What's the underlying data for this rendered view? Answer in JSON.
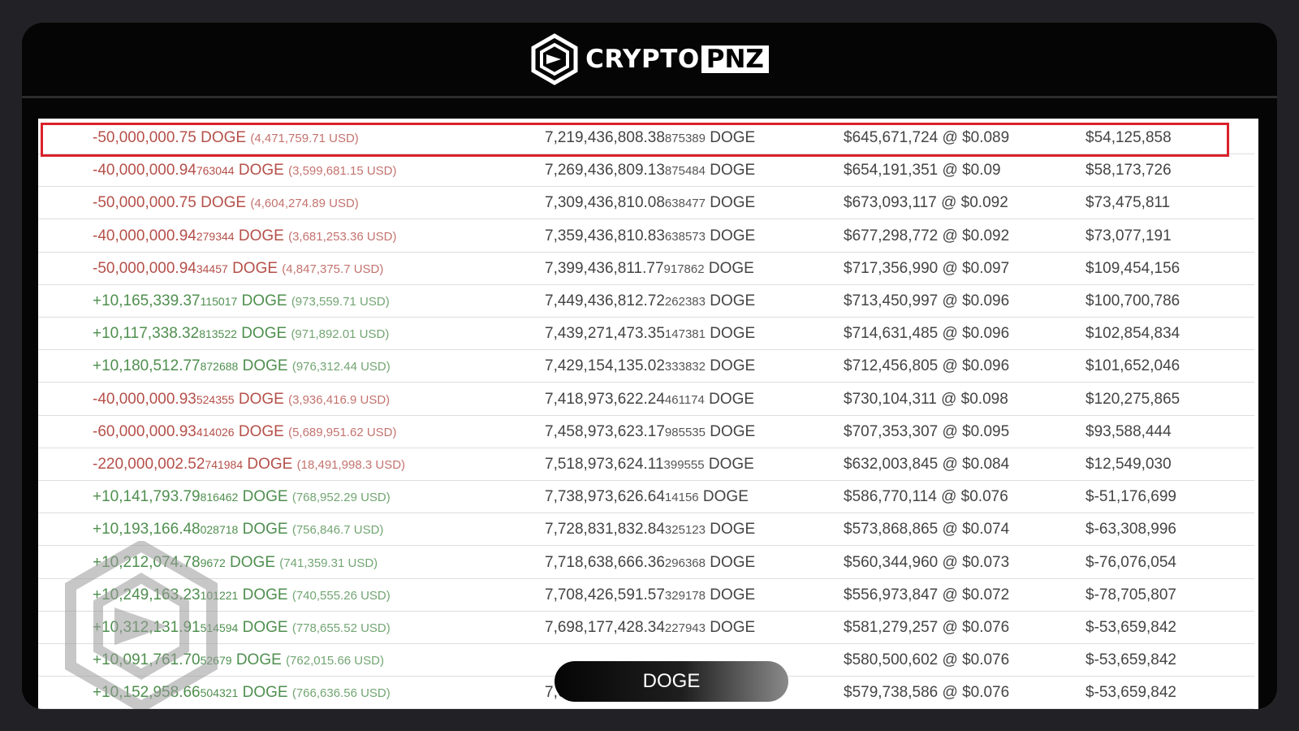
{
  "brand": {
    "name_part1": "CRYPTO",
    "name_part2": "PNZ",
    "icon": "cube-hexagon-logo-icon"
  },
  "overlay": {
    "label": "DOGE"
  },
  "colors": {
    "negative": "#b5504a",
    "positive": "#4f8f4f",
    "highlight_border": "#d9222a"
  },
  "highlighted_row": 0,
  "rows": [
    {
      "sign": "neg",
      "change_main": "-50,000,000.75",
      "change_small": "",
      "unit": "DOGE",
      "usd": "(4,471,759.71 USD)",
      "bal_main": "7,219,436,808.38",
      "bal_small": "875389",
      "bal_unit": "DOGE",
      "value": "$645,671,724 @ $0.089",
      "pnl": "$54,125,858"
    },
    {
      "sign": "neg",
      "change_main": "-40,000,000.94",
      "change_small": "763044",
      "unit": "DOGE",
      "usd": "(3,599,681.15 USD)",
      "bal_main": "7,269,436,809.13",
      "bal_small": "875484",
      "bal_unit": "DOGE",
      "value": "$654,191,351 @ $0.09",
      "pnl": "$58,173,726"
    },
    {
      "sign": "neg",
      "change_main": "-50,000,000.75",
      "change_small": "",
      "unit": "DOGE",
      "usd": "(4,604,274.89 USD)",
      "bal_main": "7,309,436,810.08",
      "bal_small": "638477",
      "bal_unit": "DOGE",
      "value": "$673,093,117 @ $0.092",
      "pnl": "$73,475,811"
    },
    {
      "sign": "neg",
      "change_main": "-40,000,000.94",
      "change_small": "279344",
      "unit": "DOGE",
      "usd": "(3,681,253.36 USD)",
      "bal_main": "7,359,436,810.83",
      "bal_small": "638573",
      "bal_unit": "DOGE",
      "value": "$677,298,772 @ $0.092",
      "pnl": "$73,077,191"
    },
    {
      "sign": "neg",
      "change_main": "-50,000,000.94",
      "change_small": "34457",
      "unit": "DOGE",
      "usd": "(4,847,375.7 USD)",
      "bal_main": "7,399,436,811.77",
      "bal_small": "917862",
      "bal_unit": "DOGE",
      "value": "$717,356,990 @ $0.097",
      "pnl": "$109,454,156"
    },
    {
      "sign": "pos",
      "change_main": "+10,165,339.37",
      "change_small": "115017",
      "unit": "DOGE",
      "usd": "(973,559.71 USD)",
      "bal_main": "7,449,436,812.72",
      "bal_small": "262383",
      "bal_unit": "DOGE",
      "value": "$713,450,997 @ $0.096",
      "pnl": "$100,700,786"
    },
    {
      "sign": "pos",
      "change_main": "+10,117,338.32",
      "change_small": "813522",
      "unit": "DOGE",
      "usd": "(971,892.01 USD)",
      "bal_main": "7,439,271,473.35",
      "bal_small": "147381",
      "bal_unit": "DOGE",
      "value": "$714,631,485 @ $0.096",
      "pnl": "$102,854,834"
    },
    {
      "sign": "pos",
      "change_main": "+10,180,512.77",
      "change_small": "872688",
      "unit": "DOGE",
      "usd": "(976,312.44 USD)",
      "bal_main": "7,429,154,135.02",
      "bal_small": "333832",
      "bal_unit": "DOGE",
      "value": "$712,456,805 @ $0.096",
      "pnl": "$101,652,046"
    },
    {
      "sign": "neg",
      "change_main": "-40,000,000.93",
      "change_small": "524355",
      "unit": "DOGE",
      "usd": "(3,936,416.9 USD)",
      "bal_main": "7,418,973,622.24",
      "bal_small": "461174",
      "bal_unit": "DOGE",
      "value": "$730,104,311 @ $0.098",
      "pnl": "$120,275,865"
    },
    {
      "sign": "neg",
      "change_main": "-60,000,000.93",
      "change_small": "414026",
      "unit": "DOGE",
      "usd": "(5,689,951.62 USD)",
      "bal_main": "7,458,973,623.17",
      "bal_small": "985535",
      "bal_unit": "DOGE",
      "value": "$707,353,307 @ $0.095",
      "pnl": "$93,588,444"
    },
    {
      "sign": "neg",
      "change_main": "-220,000,002.52",
      "change_small": "741984",
      "unit": "DOGE",
      "usd": "(18,491,998.3 USD)",
      "bal_main": "7,518,973,624.11",
      "bal_small": "399555",
      "bal_unit": "DOGE",
      "value": "$632,003,845 @ $0.084",
      "pnl": "$12,549,030"
    },
    {
      "sign": "pos",
      "change_main": "+10,141,793.79",
      "change_small": "816462",
      "unit": "DOGE",
      "usd": "(768,952.29 USD)",
      "bal_main": "7,738,973,626.64",
      "bal_small": "14156",
      "bal_unit": "DOGE",
      "value": "$586,770,114 @ $0.076",
      "pnl": "$-51,176,699"
    },
    {
      "sign": "pos",
      "change_main": "+10,193,166.48",
      "change_small": "028718",
      "unit": "DOGE",
      "usd": "(756,846.7 USD)",
      "bal_main": "7,728,831,832.84",
      "bal_small": "325123",
      "bal_unit": "DOGE",
      "value": "$573,868,865 @ $0.074",
      "pnl": "$-63,308,996"
    },
    {
      "sign": "pos",
      "change_main": "+10,212,074.78",
      "change_small": "9672",
      "unit": "DOGE",
      "usd": "(741,359.31 USD)",
      "bal_main": "7,718,638,666.36",
      "bal_small": "296368",
      "bal_unit": "DOGE",
      "value": "$560,344,960 @ $0.073",
      "pnl": "$-76,076,054"
    },
    {
      "sign": "pos",
      "change_main": "+10,249,163.23",
      "change_small": "101221",
      "unit": "DOGE",
      "usd": "(740,555.26 USD)",
      "bal_main": "7,708,426,591.57",
      "bal_small": "329178",
      "bal_unit": "DOGE",
      "value": "$556,973,847 @ $0.072",
      "pnl": "$-78,705,807"
    },
    {
      "sign": "pos",
      "change_main": "+10,312,131.91",
      "change_small": "514594",
      "unit": "DOGE",
      "usd": "(778,655.52 USD)",
      "bal_main": "7,698,177,428.34",
      "bal_small": "227943",
      "bal_unit": "DOGE",
      "value": "$581,279,257 @ $0.076",
      "pnl": "$-53,659,842"
    },
    {
      "sign": "pos",
      "change_main": "+10,091,761.70",
      "change_small": "52679",
      "unit": "DOGE",
      "usd": "(762,015.66 USD)",
      "bal_main": "",
      "bal_small": "",
      "bal_unit": "",
      "value": "$580,500,602 @ $0.076",
      "pnl": "$-53,659,842"
    },
    {
      "sign": "pos",
      "change_main": "+10,152,958.66",
      "change_small": "504321",
      "unit": "DOGE",
      "usd": "(766,636.56 USD)",
      "bal_main": "7,677,773,534.72",
      "bal_small": "186661",
      "bal_unit": "DOGE",
      "value": "$579,738,586 @ $0.076",
      "pnl": "$-53,659,842"
    }
  ]
}
